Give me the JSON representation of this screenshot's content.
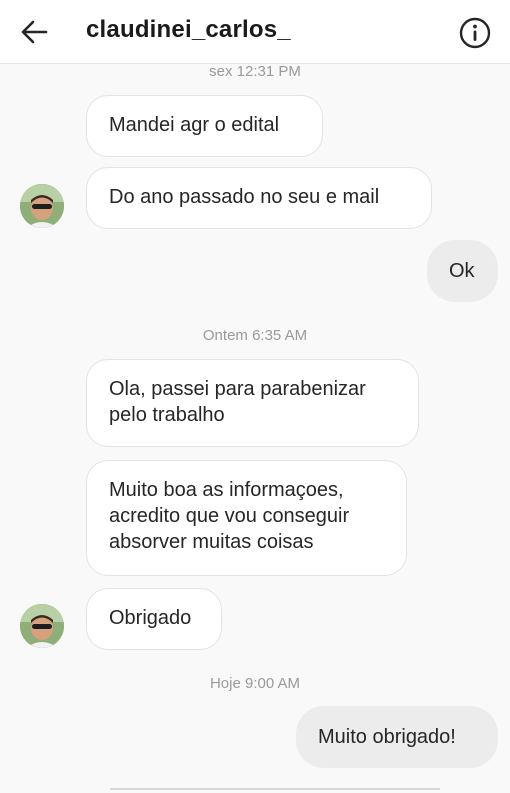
{
  "header": {
    "username": "claudinei_carlos_",
    "back_icon": "arrow-left-icon",
    "info_icon": "info-circle-icon"
  },
  "chat": {
    "timestamps": [
      "sex 12:31 PM",
      "Ontem 6:35 AM",
      "Hoje 9:00 AM"
    ],
    "messages": [
      {
        "from": "contact",
        "text": "Mandei agr o edital"
      },
      {
        "from": "contact",
        "text": "Do ano passado no seu e mail"
      },
      {
        "from": "me",
        "text": "Ok"
      },
      {
        "from": "contact",
        "text": "Ola, passei para parabenizar pelo trabalho"
      },
      {
        "from": "contact",
        "text": "Muito boa as informaçoes, acredito que vou conseguir absorver muitas coisas"
      },
      {
        "from": "contact",
        "text": "Obrigado"
      },
      {
        "from": "me",
        "text": "Muito obrigado!"
      }
    ]
  },
  "colors": {
    "incoming_bubble": "#ffffff",
    "outgoing_bubble": "#ececec",
    "timestamp": "#9a9a9a"
  }
}
